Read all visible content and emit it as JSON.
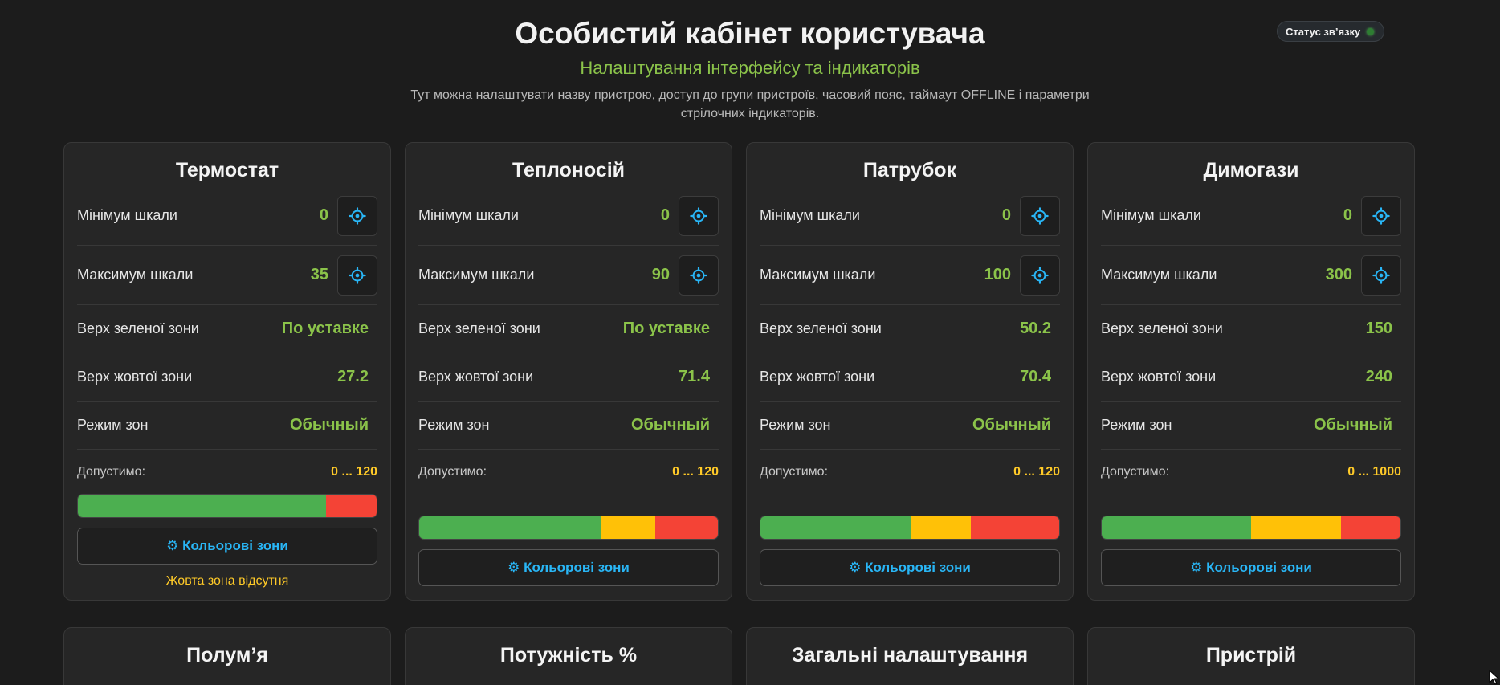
{
  "header": {
    "title": "Особистий кабінет користувача",
    "subtitle": "Налаштування інтерфейсу та індикаторів",
    "description": "Тут можна налаштувати назву пристрою, доступ до групи пристроїв, часовий пояс, таймаут OFFLINE і параметри стрілочних індикаторів."
  },
  "status": {
    "label": "Статус зв’язку",
    "color": "#2e7d32"
  },
  "labels": {
    "min": "Мінімум шкали",
    "max": "Максимум шкали",
    "green_top": "Верх зеленої зони",
    "yellow_top": "Верх жовтої зони",
    "zone_mode": "Режим зон",
    "allowed": "Допустимо:",
    "zones_button": "⚙ Кольорові зони"
  },
  "cards": [
    {
      "title": "Термостат",
      "min": "0",
      "max": "35",
      "green_top": "По уставке",
      "yellow_top": "27.2",
      "zone_mode": "Обычный",
      "allowed": "0 ... 120",
      "bar": {
        "green": 0.83,
        "yellow": 0.0,
        "red": 0.17
      },
      "note": "Жовта зона відсутня"
    },
    {
      "title": "Теплоносій",
      "min": "0",
      "max": "90",
      "green_top": "По уставке",
      "yellow_top": "71.4",
      "zone_mode": "Обычный",
      "allowed": "0 ... 120",
      "bar": {
        "green": 0.61,
        "yellow": 0.18,
        "red": 0.21
      }
    },
    {
      "title": "Патрубок",
      "min": "0",
      "max": "100",
      "green_top": "50.2",
      "yellow_top": "70.4",
      "zone_mode": "Обычный",
      "allowed": "0 ... 120",
      "bar": {
        "green": 0.502,
        "yellow": 0.202,
        "red": 0.296
      }
    },
    {
      "title": "Димогази",
      "min": "0",
      "max": "300",
      "green_top": "150",
      "yellow_top": "240",
      "zone_mode": "Обычный",
      "allowed": "0 ... 1000",
      "bar": {
        "green": 0.5,
        "yellow": 0.3,
        "red": 0.2
      }
    }
  ],
  "bottom_cards": [
    {
      "title": "Полум’я"
    },
    {
      "title": "Потужність %"
    },
    {
      "title": "Загальні налаштування"
    },
    {
      "title": "Пристрій"
    }
  ],
  "colors": {
    "accent_green": "#8bc34a",
    "accent_blue": "#29b6f6",
    "warning_yellow": "#ffca28",
    "zone_green": "#4caf50",
    "zone_yellow": "#ffc107",
    "zone_red": "#f44336"
  },
  "icons": {
    "stepper": "gear-icon",
    "status": "status-dot-icon",
    "cursor": "mouse-cursor-icon"
  }
}
